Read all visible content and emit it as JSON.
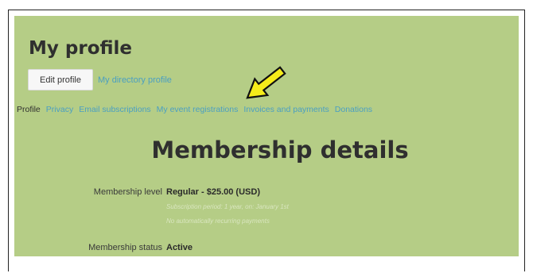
{
  "page": {
    "title": "My profile"
  },
  "actions": {
    "edit_profile": "Edit profile",
    "directory_profile": "My directory profile"
  },
  "tabs": [
    {
      "label": "Profile",
      "active": true
    },
    {
      "label": "Privacy"
    },
    {
      "label": "Email subscriptions"
    },
    {
      "label": "My event registrations"
    },
    {
      "label": "Invoices and payments"
    },
    {
      "label": "Donations"
    }
  ],
  "membership": {
    "section_title": "Membership details",
    "level_label": "Membership level",
    "level_value": "Regular - $25.00 (USD)",
    "subscription_note": "Subscription period: 1 year, on: January 1st",
    "recurring_note": "No automatically recurring payments",
    "status_label": "Membership status",
    "status_value": "Active"
  },
  "annotation": {
    "arrow_color": "#f5ec1a",
    "points_to": "tab My event registrations",
    "icon": "arrow-icon"
  },
  "colors": {
    "panel_background": "#b5cd86",
    "link": "#4a9fc2"
  }
}
